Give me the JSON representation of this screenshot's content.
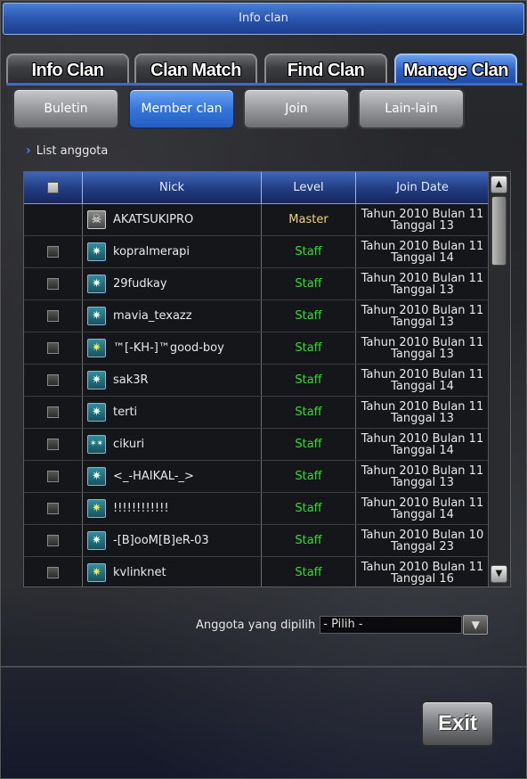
{
  "window": {
    "title": "Info clan"
  },
  "tabs": [
    {
      "label": "Info Clan",
      "active": false
    },
    {
      "label": "Clan Match",
      "active": false
    },
    {
      "label": "Find Clan",
      "active": false
    },
    {
      "label": "Manage Clan",
      "active": true
    }
  ],
  "subtabs": [
    {
      "label": "Buletin",
      "active": false
    },
    {
      "label": "Member clan",
      "active": true
    },
    {
      "label": "Join",
      "active": false
    },
    {
      "label": "Lain-lain",
      "active": false
    }
  ],
  "section": {
    "label": "List anggota"
  },
  "table": {
    "headers": {
      "nick": "Nick",
      "level": "Level",
      "join_date": "Join Date"
    },
    "rows": [
      {
        "nick": "AKATSUKIPRO",
        "level": "Master",
        "jd1": "Tahun 2010 Bulan 11",
        "jd2": "Tanggal 13",
        "checkbox": false,
        "icon": "skull-rank-icon"
      },
      {
        "nick": "kopralmerapi",
        "level": "Staff",
        "jd1": "Tahun 2010 Bulan 11",
        "jd2": "Tanggal 14",
        "checkbox": true,
        "icon": "star-rank-icon"
      },
      {
        "nick": "29fudkay",
        "level": "Staff",
        "jd1": "Tahun 2010 Bulan 11",
        "jd2": "Tanggal 13",
        "checkbox": true,
        "icon": "star-rank-icon"
      },
      {
        "nick": "mavia_texazz",
        "level": "Staff",
        "jd1": "Tahun 2010 Bulan 11",
        "jd2": "Tanggal 13",
        "checkbox": true,
        "icon": "star-rank-icon"
      },
      {
        "nick": "™[-KH-]™good-boy",
        "level": "Staff",
        "jd1": "Tahun 2010 Bulan 11",
        "jd2": "Tanggal 13",
        "checkbox": true,
        "icon": "gold-star-rank-icon"
      },
      {
        "nick": "sak3R",
        "level": "Staff",
        "jd1": "Tahun 2010 Bulan 11",
        "jd2": "Tanggal 14",
        "checkbox": true,
        "icon": "star-rank-icon"
      },
      {
        "nick": "terti",
        "level": "Staff",
        "jd1": "Tahun 2010 Bulan 11",
        "jd2": "Tanggal 13",
        "checkbox": true,
        "icon": "star-rank-icon"
      },
      {
        "nick": "cikuri",
        "level": "Staff",
        "jd1": "Tahun 2010 Bulan 11",
        "jd2": "Tanggal 14",
        "checkbox": true,
        "icon": "double-star-rank-icon"
      },
      {
        "nick": "<_-HAIKAL-_>",
        "level": "Staff",
        "jd1": "Tahun 2010 Bulan 11",
        "jd2": "Tanggal 13",
        "checkbox": true,
        "icon": "star-rank-icon"
      },
      {
        "nick": "!!!!!!!!!!!!",
        "level": "Staff",
        "jd1": "Tahun 2010 Bulan 11",
        "jd2": "Tanggal 14",
        "checkbox": true,
        "icon": "gold-star-rank-icon"
      },
      {
        "nick": "-[B]ooM[B]eR-03",
        "level": "Staff",
        "jd1": "Tahun 2010 Bulan 10",
        "jd2": "Tanggal 23",
        "checkbox": true,
        "icon": "star-rank-icon"
      },
      {
        "nick": "kvlinknet",
        "level": "Staff",
        "jd1": "Tahun 2010 Bulan 11",
        "jd2": "Tanggal 16",
        "checkbox": true,
        "icon": "gold-star-rank-icon"
      }
    ]
  },
  "selector": {
    "label": "Anggota yang dipilih",
    "value": "- Pilih -"
  },
  "exit_button": {
    "label": "Exit"
  },
  "colors": {
    "master": "#f2d27a",
    "staff": "#33dd33",
    "accent": "#3576da"
  }
}
